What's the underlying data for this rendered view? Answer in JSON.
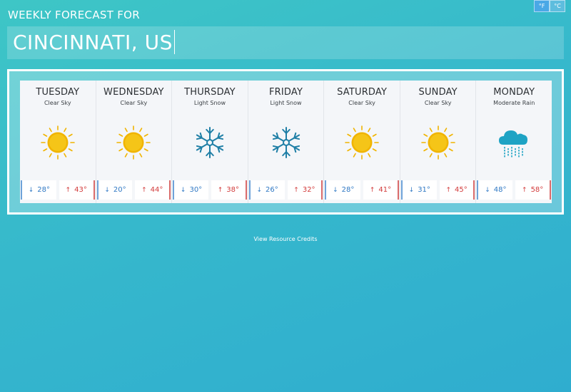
{
  "header": {
    "label": "WEEKLY FORECAST FOR",
    "city_value": "CINCINNATI, US"
  },
  "units": {
    "fahrenheit": "°F",
    "celsius": "°C"
  },
  "days": [
    {
      "name": "TUESDAY",
      "condition": "Clear Sky",
      "icon": "sun-icon",
      "low": "28°",
      "high": "43°"
    },
    {
      "name": "WEDNESDAY",
      "condition": "Clear Sky",
      "icon": "sun-icon",
      "low": "20°",
      "high": "44°"
    },
    {
      "name": "THURSDAY",
      "condition": "Light Snow",
      "icon": "snowflake-icon",
      "low": "30°",
      "high": "38°"
    },
    {
      "name": "FRIDAY",
      "condition": "Light Snow",
      "icon": "snowflake-icon",
      "low": "26°",
      "high": "32°"
    },
    {
      "name": "SATURDAY",
      "condition": "Clear Sky",
      "icon": "sun-icon",
      "low": "28°",
      "high": "41°"
    },
    {
      "name": "SUNDAY",
      "condition": "Clear Sky",
      "icon": "sun-icon",
      "low": "31°",
      "high": "45°"
    },
    {
      "name": "MONDAY",
      "condition": "Moderate Rain",
      "icon": "rain-cloud-icon",
      "low": "48°",
      "high": "58°"
    }
  ],
  "arrows": {
    "down": "↓",
    "up": "↑"
  },
  "footer": {
    "credits": "View Resource Credits"
  },
  "colors": {
    "sun": "#f5c518",
    "sun_ray": "#f0b400",
    "snow": "#1f7fa6",
    "rain_cloud": "#1ea3c4",
    "low_temp": "#2f78c4",
    "high_temp": "#d23a3a"
  }
}
